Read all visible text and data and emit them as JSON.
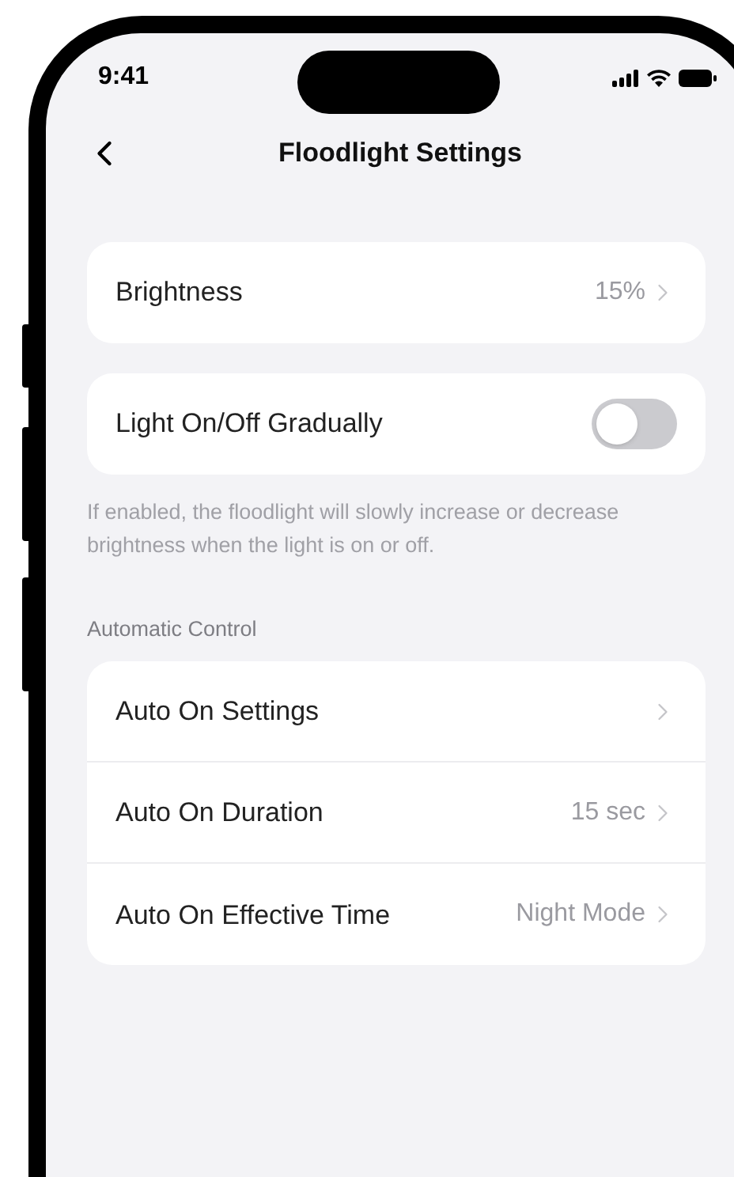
{
  "status_bar": {
    "time": "9:41"
  },
  "header": {
    "title": "Floodlight Settings"
  },
  "brightness": {
    "label": "Brightness",
    "value": "15%"
  },
  "gradual": {
    "label": "Light On/Off Gradually",
    "on": false,
    "description": "If enabled, the floodlight will slowly increase or decrease brightness when the light is on or off."
  },
  "automatic_control": {
    "heading": "Automatic Control",
    "rows": [
      {
        "label": "Auto On Settings"
      },
      {
        "label": "Auto On Duration",
        "value": "15 sec"
      },
      {
        "label": "Auto On Effective Time",
        "value": "Night Mode"
      }
    ]
  }
}
